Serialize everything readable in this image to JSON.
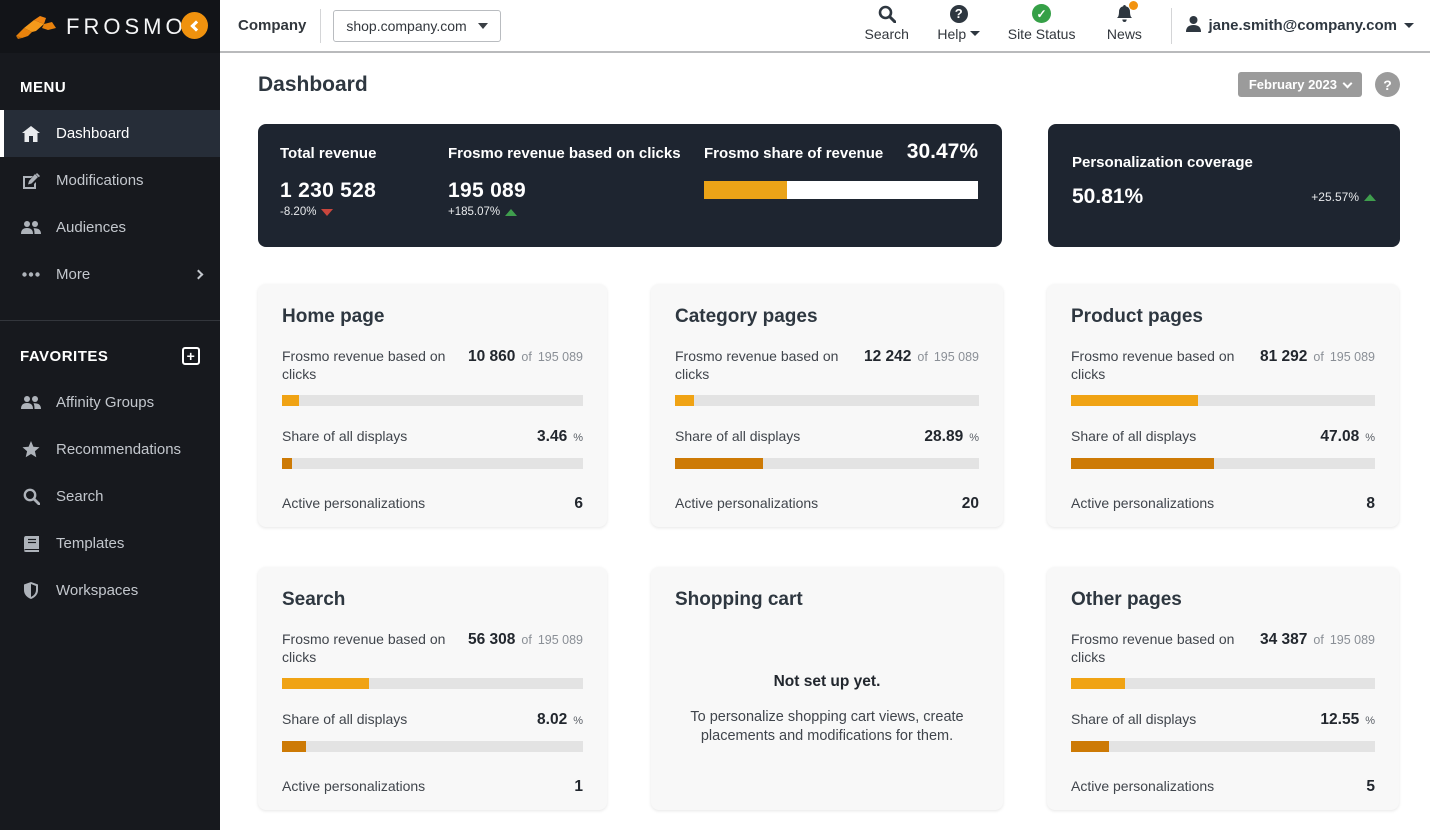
{
  "brand": {
    "name": "FROSMO"
  },
  "topbar": {
    "company_label": "Company",
    "site_selector_value": "shop.company.com",
    "nav": {
      "search": "Search",
      "help": "Help",
      "site_status": "Site Status",
      "news": "News"
    },
    "status_check_glyph": "✓",
    "help_glyph": "?",
    "user_email": "jane.smith@company.com"
  },
  "sidebar": {
    "menu_header": "MENU",
    "menu_items": [
      {
        "label": "Dashboard",
        "icon": "home-icon",
        "active": true
      },
      {
        "label": "Modifications",
        "icon": "edit-icon",
        "active": false
      },
      {
        "label": "Audiences",
        "icon": "users-icon",
        "active": false
      },
      {
        "label": "More",
        "icon": "ellipsis-icon",
        "active": false
      }
    ],
    "favorites_header": "FAVORITES",
    "favorites_add_glyph": "+",
    "favorites_items": [
      {
        "label": "Affinity Groups",
        "icon": "users-icon"
      },
      {
        "label": "Recommendations",
        "icon": "star-icon"
      },
      {
        "label": "Search",
        "icon": "search-icon"
      },
      {
        "label": "Templates",
        "icon": "book-icon"
      },
      {
        "label": "Workspaces",
        "icon": "shield-icon"
      }
    ]
  },
  "page": {
    "title": "Dashboard",
    "period_selector": "February 2023",
    "help_button": "?"
  },
  "hero": {
    "total_revenue": {
      "label": "Total revenue",
      "value": "1 230 528",
      "change": "-8.20%",
      "direction": "down"
    },
    "frosmo_revenue": {
      "label": "Frosmo revenue based on clicks",
      "value": "195 089",
      "change": "+185.07%",
      "direction": "up"
    },
    "share_of_revenue": {
      "label": "Frosmo share of revenue",
      "value": "30.47%",
      "bar_percent": 30.47
    },
    "coverage": {
      "label": "Personalization coverage",
      "value": "50.81%",
      "change": "+25.57%",
      "direction": "up"
    }
  },
  "cards": [
    {
      "title": "Home page",
      "revenue_label": "Frosmo revenue based on clicks",
      "revenue_value": "10 860",
      "of_word": "of",
      "revenue_total": "195 089",
      "revenue_percent": 5.57,
      "share_label": "Share of all displays",
      "share_value": "3.46",
      "share_unit": "%",
      "share_percent": 3.46,
      "active_label": "Active personalizations",
      "active_value": "6"
    },
    {
      "title": "Category pages",
      "revenue_label": "Frosmo revenue based on clicks",
      "revenue_value": "12 242",
      "of_word": "of",
      "revenue_total": "195 089",
      "revenue_percent": 6.27,
      "share_label": "Share of all displays",
      "share_value": "28.89",
      "share_unit": "%",
      "share_percent": 28.89,
      "active_label": "Active personalizations",
      "active_value": "20"
    },
    {
      "title": "Product pages",
      "revenue_label": "Frosmo revenue based on clicks",
      "revenue_value": "81 292",
      "of_word": "of",
      "revenue_total": "195 089",
      "revenue_percent": 41.67,
      "share_label": "Share of all displays",
      "share_value": "47.08",
      "share_unit": "%",
      "share_percent": 47.08,
      "active_label": "Active personalizations",
      "active_value": "8"
    },
    {
      "title": "Search",
      "revenue_label": "Frosmo revenue based on clicks",
      "revenue_value": "56 308",
      "of_word": "of",
      "revenue_total": "195 089",
      "revenue_percent": 28.86,
      "share_label": "Share of all displays",
      "share_value": "8.02",
      "share_unit": "%",
      "share_percent": 8.02,
      "active_label": "Active personalizations",
      "active_value": "1"
    },
    {
      "title": "Shopping cart",
      "empty_title": "Not set up yet.",
      "empty_text": "To personalize shopping cart views, create placements and modifications for them."
    },
    {
      "title": "Other pages",
      "revenue_label": "Frosmo revenue based on clicks",
      "revenue_value": "34 387",
      "of_word": "of",
      "revenue_total": "195 089",
      "revenue_percent": 17.63,
      "share_label": "Share of all displays",
      "share_value": "12.55",
      "share_unit": "%",
      "share_percent": 12.55,
      "active_label": "Active personalizations",
      "active_value": "5"
    }
  ],
  "colors": {
    "brand_orange": "#f0920e",
    "amber_bar": "#f0a314",
    "dark_orange_bar": "#cd7a05",
    "hero_card_bg": "#1e2530",
    "sidebar_bg": "#17191e",
    "positive_green": "#3f9e4d",
    "negative_red": "#c9463d",
    "status_green": "#35a047"
  }
}
